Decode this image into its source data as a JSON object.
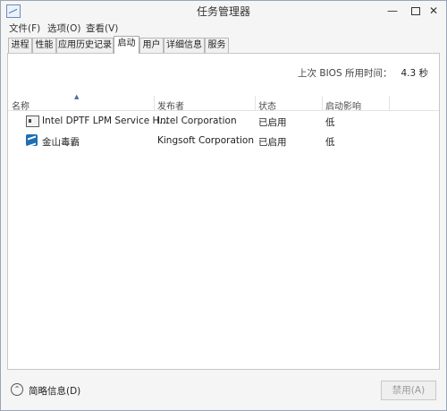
{
  "window": {
    "title": "任务管理器"
  },
  "menu": [
    "文件(F)",
    "选项(O)",
    "查看(V)"
  ],
  "tabs": [
    "进程",
    "性能",
    "应用历史记录",
    "启动",
    "用户",
    "详细信息",
    "服务"
  ],
  "active_tab": "启动",
  "bios": {
    "label": "上次 BIOS 所用时间：",
    "value": "4.3 秒"
  },
  "columns": [
    "名称",
    "发布者",
    "状态",
    "启动影响"
  ],
  "rows": [
    {
      "name": "Intel DPTF LPM Service H...",
      "publisher": "Intel Corporation",
      "status": "已启用",
      "impact": "低",
      "icon": "service-icon"
    },
    {
      "name": "金山毒霸",
      "publisher": "Kingsoft Corporation",
      "status": "已启用",
      "impact": "低",
      "icon": "kingsoft-icon"
    }
  ],
  "footer": {
    "less_details": "简略信息(D)",
    "disable": "禁用(A)"
  }
}
